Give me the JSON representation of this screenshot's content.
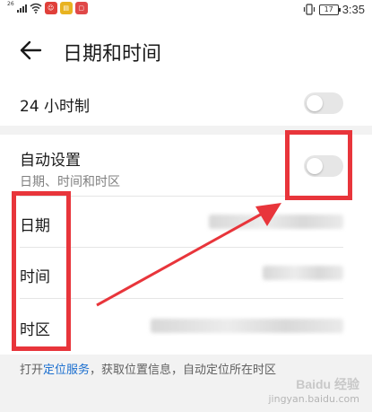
{
  "status_bar": {
    "signal_label": "26",
    "time": "3:35",
    "battery": "17",
    "apps": [
      {
        "name": "app-icon-red",
        "color": "#e0403a",
        "glyph": "☺"
      },
      {
        "name": "app-icon-yellow",
        "color": "#e8b320",
        "glyph": "▤"
      },
      {
        "name": "app-icon-red2",
        "color": "#e04848",
        "glyph": "▢"
      }
    ]
  },
  "header": {
    "title": "日期和时间",
    "back_icon": "arrow-left-icon"
  },
  "settings": {
    "hour24": {
      "label": "24 小时制",
      "toggle_on": false
    },
    "auto": {
      "label": "自动设置",
      "sublabel": "日期、时间和时区",
      "toggle_on": false
    },
    "date": {
      "label": "日期"
    },
    "time": {
      "label": "时间"
    },
    "timezone": {
      "label": "时区"
    }
  },
  "footnote": {
    "before": "打开",
    "link": "定位服务",
    "after": "，获取位置信息，自动定位所在时区"
  },
  "watermark": {
    "brand": "Baidu 经验",
    "url": "jingyan.baidu.com"
  },
  "colors": {
    "annotation": "#e8353b",
    "link": "#1a6ecf",
    "toggle_off": "#e6e6e6"
  }
}
